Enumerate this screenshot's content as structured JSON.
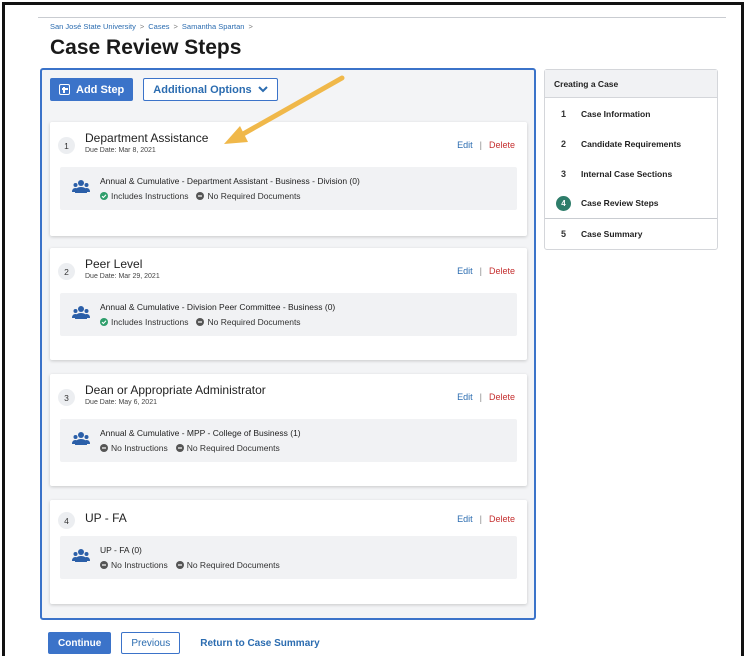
{
  "breadcrumb": [
    "San José State University",
    "Cases",
    "Samantha Spartan"
  ],
  "breadcrumb_sep": ">",
  "page_title": "Case Review Steps",
  "toolbar": {
    "add_step_label": "Add Step",
    "additional_options_label": "Additional Options"
  },
  "actions": {
    "edit_label": "Edit",
    "delete_label": "Delete",
    "separator": "|"
  },
  "steps": [
    {
      "number": "1",
      "title": "Department Assistance",
      "due": "Due Date: Mar 8, 2021",
      "reviewer": "Annual & Cumulative - Department Assistant - Business - Division (0)",
      "instructions": "Includes Instructions",
      "documents": "No Required Documents"
    },
    {
      "number": "2",
      "title": "Peer Level",
      "due": "Due Date: Mar 29, 2021",
      "reviewer": "Annual & Cumulative - Division Peer Committee - Business (0)",
      "instructions": "Includes Instructions",
      "documents": "No Required Documents"
    },
    {
      "number": "3",
      "title": "Dean or Appropriate Administrator",
      "due": "Due Date: May 6, 2021",
      "reviewer": "Annual & Cumulative - MPP - College of Business (1)",
      "instructions": "No Instructions",
      "documents": "No Required Documents"
    },
    {
      "number": "4",
      "title": "UP - FA",
      "due": "",
      "reviewer": "UP - FA (0)",
      "instructions": "No Instructions",
      "documents": "No Required Documents"
    }
  ],
  "sidebar": {
    "header": "Creating a Case",
    "items": [
      {
        "number": "1",
        "label": "Case Information"
      },
      {
        "number": "2",
        "label": "Candidate Requirements"
      },
      {
        "number": "3",
        "label": "Internal Case Sections"
      },
      {
        "number": "4",
        "label": "Case Review Steps",
        "active": true
      },
      {
        "number": "5",
        "label": "Case Summary"
      }
    ]
  },
  "footer": {
    "continue_label": "Continue",
    "previous_label": "Previous",
    "return_label": "Return to Case Summary"
  },
  "colors": {
    "primary": "#3b73c9",
    "link": "#2b6cb0",
    "delete": "#c53030",
    "success": "#2f9e6b",
    "active_step": "#2e7d6a",
    "annotation_arrow": "#f0b84a"
  }
}
